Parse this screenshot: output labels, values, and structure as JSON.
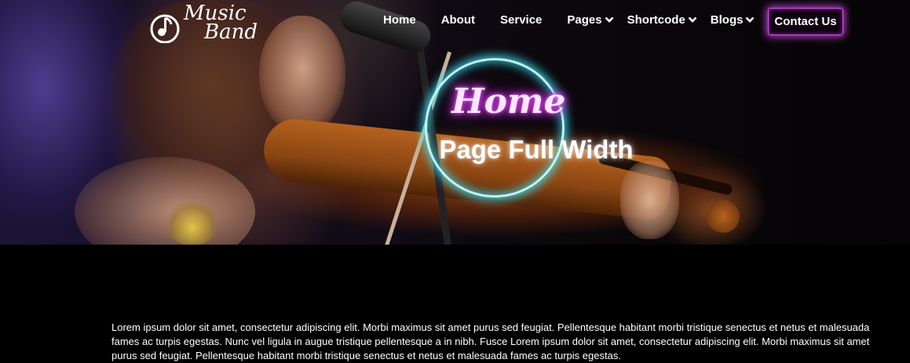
{
  "logo": {
    "line1": "Music",
    "line2": "Band",
    "icon": "music-note-icon"
  },
  "nav": {
    "items": [
      {
        "label": "Home",
        "dropdown": false
      },
      {
        "label": "About",
        "dropdown": false
      },
      {
        "label": "Service",
        "dropdown": false
      },
      {
        "label": "Pages",
        "dropdown": true
      },
      {
        "label": "Shortcode",
        "dropdown": true
      },
      {
        "label": "Blogs",
        "dropdown": true
      }
    ],
    "cta_label": "Contact Us"
  },
  "hero": {
    "script_text": "Home",
    "title": "Page Full Width"
  },
  "content": {
    "paragraph": "Lorem ipsum dolor sit amet, consectetur adipiscing elit. Morbi maximus sit amet purus sed feugiat. Pellentesque habitant morbi tristique senectus et netus et malesuada fames ac turpis egestas. Nunc vel ligula in augue tristique pellentesque a in nibh. Fusce Lorem ipsum dolor sit amet, consectetur adipiscing elit. Morbi maximus sit amet purus sed feugiat. Pellentesque habitant morbi tristique senectus et netus et malesuada fames ac turpis egestas."
  },
  "colors": {
    "neon_pink": "#d94cf0",
    "neon_cyan": "#3ee0f0",
    "background": "#000000"
  }
}
